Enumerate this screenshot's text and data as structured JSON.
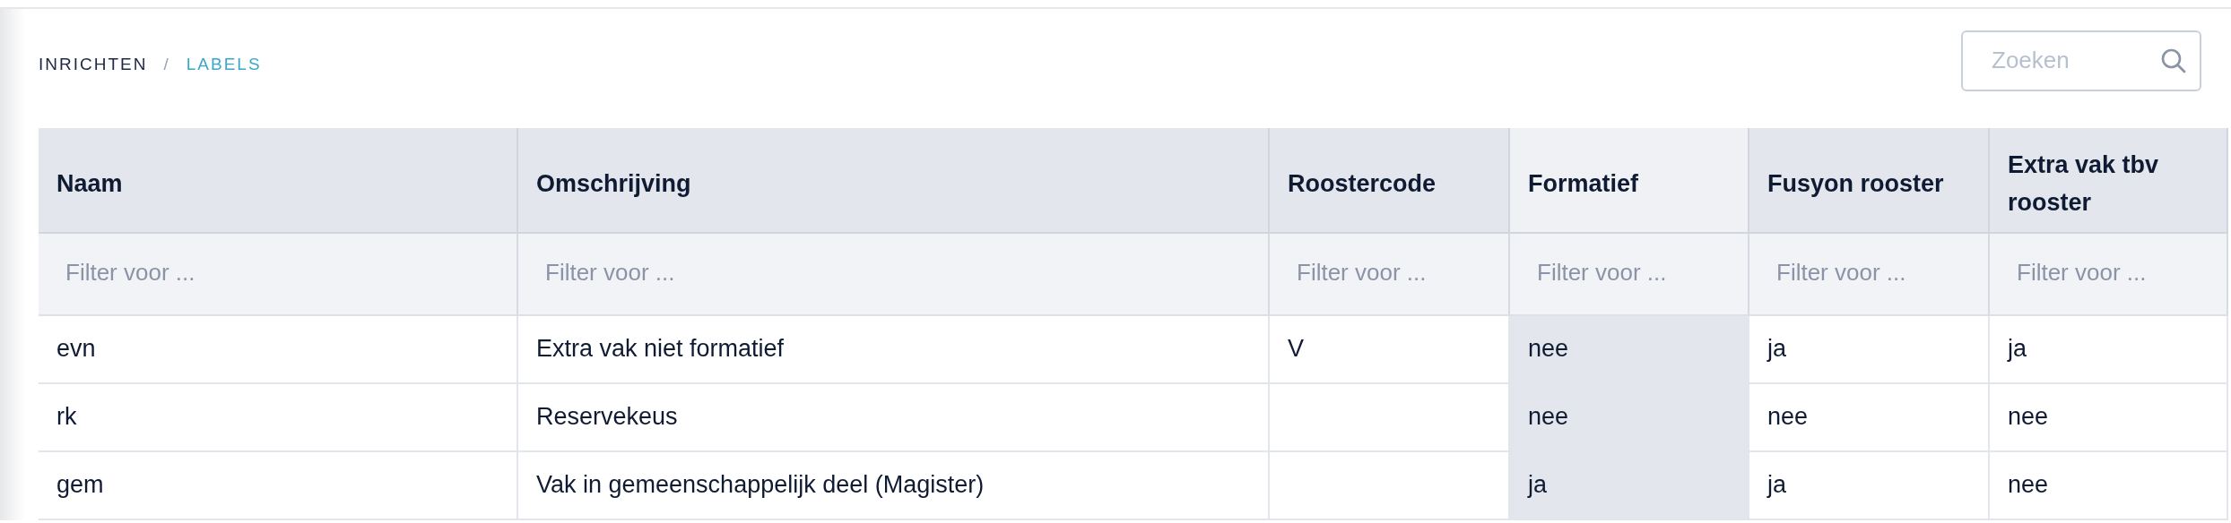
{
  "breadcrumb": {
    "separator": "/",
    "items": [
      {
        "label": "INRICHTEN",
        "selected": false
      },
      {
        "label": "LABELS",
        "selected": true
      }
    ]
  },
  "search": {
    "placeholder": "Zoeken"
  },
  "table": {
    "columns": [
      {
        "label": "Naam",
        "sorted": false,
        "filter_placeholder": "Filter voor ..."
      },
      {
        "label": "Omschrijving",
        "sorted": false,
        "filter_placeholder": "Filter voor ..."
      },
      {
        "label": "Roostercode",
        "sorted": false,
        "filter_placeholder": "Filter voor ..."
      },
      {
        "label": "Formatief",
        "sorted": true,
        "filter_placeholder": "Filter voor ..."
      },
      {
        "label": "Fusyon rooster",
        "sorted": false,
        "filter_placeholder": "Filter voor ..."
      },
      {
        "label": "Extra vak tbv rooster",
        "sorted": false,
        "filter_placeholder": "Filter voor ..."
      }
    ],
    "rows": [
      [
        "evn",
        "Extra vak niet formatief",
        "V",
        "nee",
        "ja",
        "ja"
      ],
      [
        "rk",
        "Reservekeus",
        "",
        "nee",
        "nee",
        "nee"
      ],
      [
        "gem",
        "Vak in gemeenschappelijk deel (Magister)",
        "",
        "ja",
        "ja",
        "nee"
      ]
    ]
  }
}
